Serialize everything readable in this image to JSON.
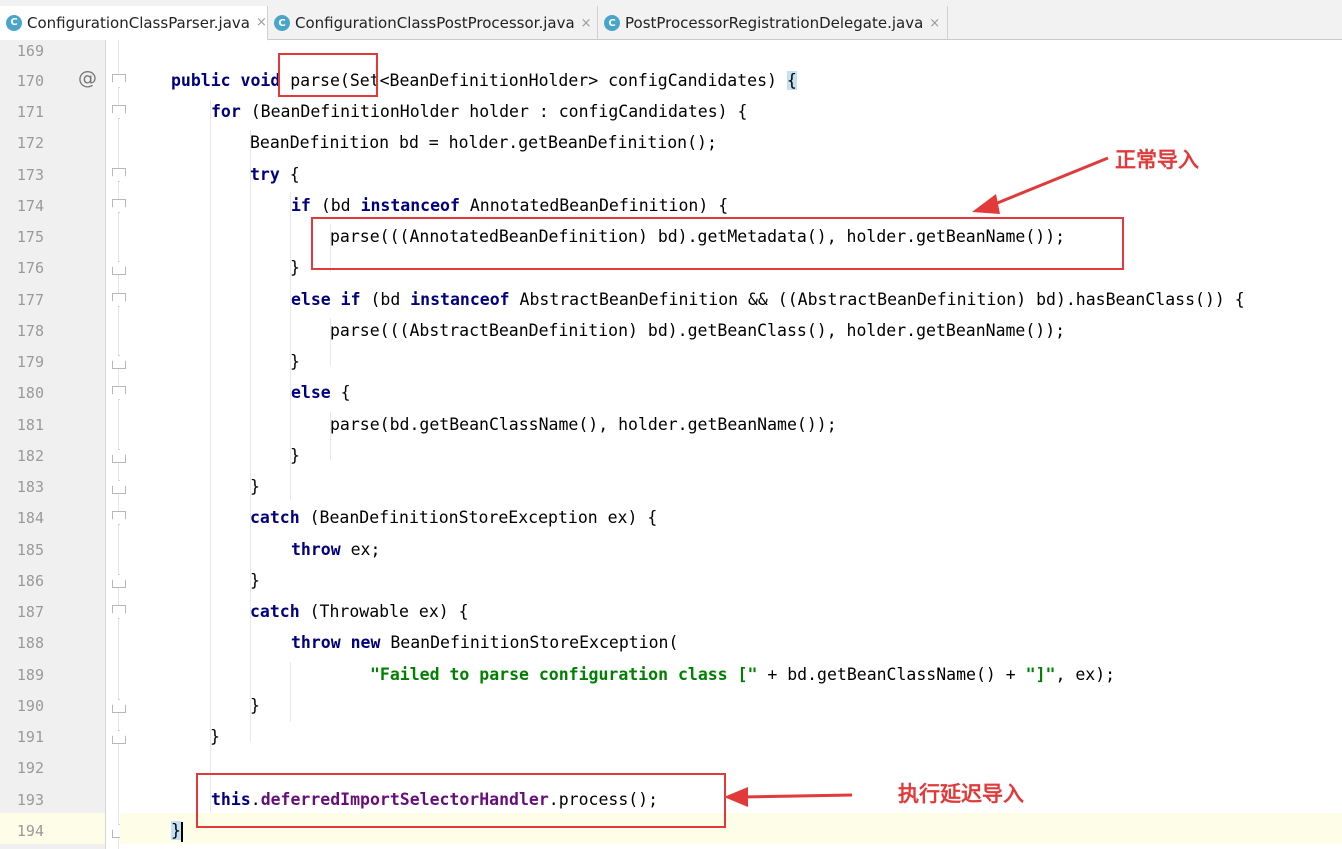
{
  "tabs": [
    {
      "icon": "C",
      "label": "ConfigurationClassParser.java",
      "close": "×"
    },
    {
      "icon": "C",
      "label": "ConfigurationClassPostProcessor.java",
      "close": "×"
    },
    {
      "icon": "C",
      "label": "PostProcessorRegistrationDelegate.java",
      "close": "×"
    }
  ],
  "gutter": {
    "line_numbers": [
      "169",
      "170",
      "171",
      "172",
      "173",
      "174",
      "175",
      "176",
      "177",
      "178",
      "179",
      "180",
      "181",
      "182",
      "183",
      "184",
      "185",
      "186",
      "187",
      "188",
      "189",
      "190",
      "191",
      "192",
      "193",
      "194"
    ],
    "override_marker": "@"
  },
  "code": {
    "l170": {
      "kw1": "public ",
      "kw2": "void ",
      "name": "parse",
      "rest": "(Set<BeanDefinitionHolder> configCandidates) ",
      "brace": "{"
    },
    "l171": {
      "kw": "for ",
      "rest": "(BeanDefinitionHolder holder : configCandidates) {"
    },
    "l172": {
      "rest": "BeanDefinition bd = holder.getBeanDefinition();"
    },
    "l173": {
      "kw": "try ",
      "rest": "{"
    },
    "l174": {
      "kw1": "if ",
      "mid": "(bd ",
      "kw2": "instanceof ",
      "rest": "AnnotatedBeanDefinition) {"
    },
    "l175": {
      "rest": "parse(((AnnotatedBeanDefinition) bd).getMetadata(), holder.getBeanName());"
    },
    "l176": {
      "rest": "}"
    },
    "l177": {
      "kw1": "else if ",
      "mid": "(bd ",
      "kw2": "instanceof ",
      "rest": "AbstractBeanDefinition && ((AbstractBeanDefinition) bd).hasBeanClass()) {"
    },
    "l178": {
      "rest": "parse(((AbstractBeanDefinition) bd).getBeanClass(), holder.getBeanName());"
    },
    "l179": {
      "rest": "}"
    },
    "l180": {
      "kw": "else ",
      "rest": "{"
    },
    "l181": {
      "rest": "parse(bd.getBeanClassName(), holder.getBeanName());"
    },
    "l182": {
      "rest": "}"
    },
    "l183": {
      "rest": "}"
    },
    "l184": {
      "kw": "catch ",
      "rest": "(BeanDefinitionStoreException ex) {"
    },
    "l185": {
      "kw": "throw ",
      "rest": "ex;"
    },
    "l186": {
      "rest": "}"
    },
    "l187": {
      "kw": "catch ",
      "rest": "(Throwable ex) {"
    },
    "l188": {
      "kw": "throw new ",
      "rest": "BeanDefinitionStoreException("
    },
    "l189": {
      "str": "\"Failed to parse configuration class [\"",
      "rest": " + bd.getBeanClassName() + ",
      "str2": "\"]\"",
      "rest2": ", ex);"
    },
    "l190": {
      "rest": "}"
    },
    "l191": {
      "rest": "}"
    },
    "l193": {
      "kw": "this",
      "dot": ".",
      "fld": "deferredImportSelectorHandler",
      "rest": ".process();"
    },
    "l194": {
      "brace": "}"
    }
  },
  "annotations": {
    "normal_import": "正常导入",
    "deferred_import": "执行延迟导入",
    "color": "#e23a3a"
  }
}
